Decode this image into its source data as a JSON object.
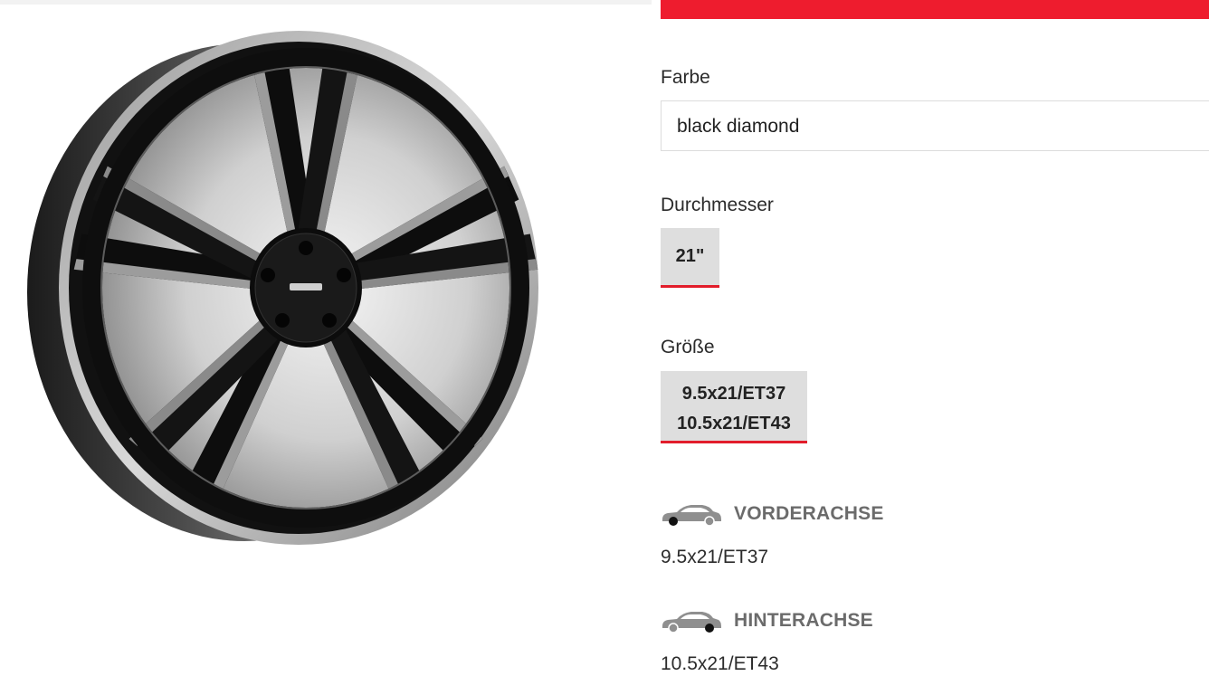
{
  "product": {
    "image_alt": "wheel rim photo",
    "colors": {
      "accent_red": "#ee1c2e",
      "chip_bg": "#dedede",
      "muted_heading": "#6b6b6b"
    }
  },
  "options": {
    "color": {
      "label": "Farbe",
      "value": "black diamond"
    },
    "diameter": {
      "label": "Durchmesser",
      "value": "21\""
    },
    "size": {
      "label": "Größe",
      "lines": [
        "9.5x21/ET37",
        "10.5x21/ET43"
      ]
    }
  },
  "axles": {
    "front": {
      "title": "VORDERACHSE",
      "value": "9.5x21/ET37",
      "icon": "car-front-axle-icon"
    },
    "rear": {
      "title": "HINTERACHSE",
      "value": "10.5x21/ET43",
      "icon": "car-rear-axle-icon"
    }
  }
}
